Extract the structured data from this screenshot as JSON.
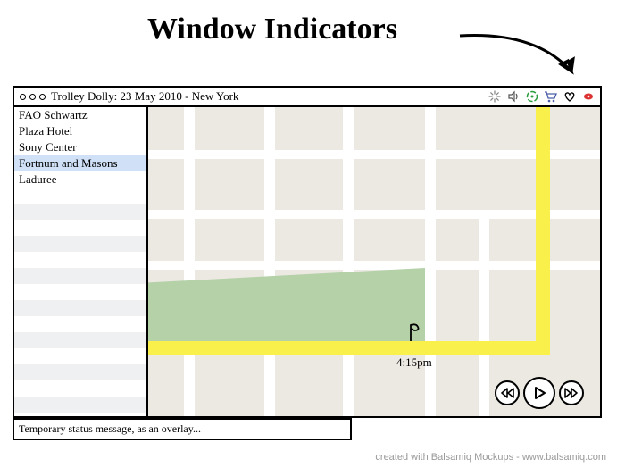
{
  "annotation": "Window Indicators",
  "window": {
    "title": "Trolley Dolly: 23 May 2010 - New York",
    "indicators": [
      "loading",
      "sound",
      "gps",
      "cart",
      "favorite",
      "record"
    ]
  },
  "sidebar": {
    "items": [
      {
        "label": "FAO Schwartz",
        "selected": false
      },
      {
        "label": "Plaza Hotel",
        "selected": false
      },
      {
        "label": "Sony Center",
        "selected": false
      },
      {
        "label": "Fortnum and Masons",
        "selected": true
      },
      {
        "label": "Laduree",
        "selected": false
      }
    ]
  },
  "map": {
    "marker_time": "4:15pm"
  },
  "playback": {
    "rewind": "rewind",
    "play": "play",
    "forward": "forward"
  },
  "status": "Temporary status message, as an overlay...",
  "credit": "created with Balsamiq Mockups - www.balsamiq.com"
}
